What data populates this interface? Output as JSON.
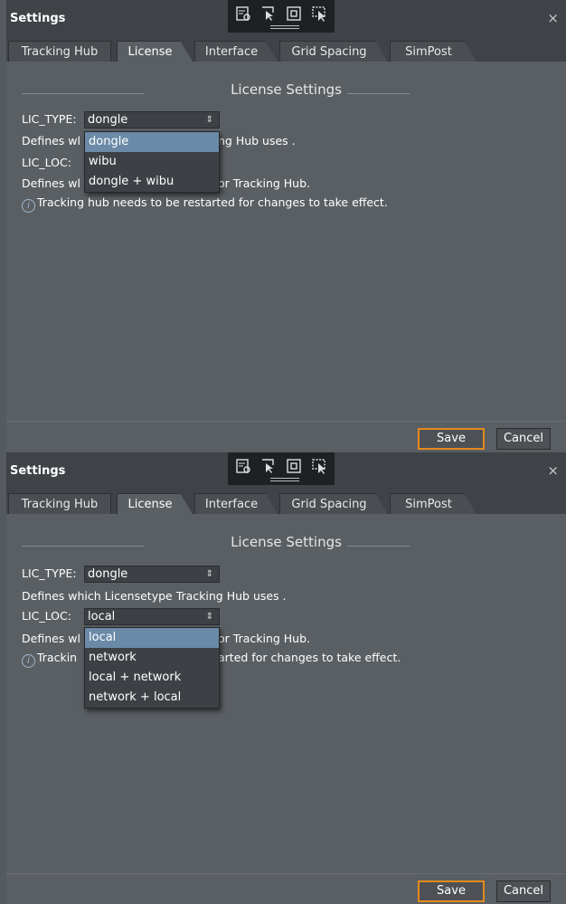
{
  "colors": {
    "accent": "#e48a1c",
    "selection": "#6a8aa7",
    "panel": "#5a5f63",
    "titlebar": "#3f4347"
  },
  "toolbar_icons": [
    "settings-list-icon",
    "select-arrow-icon",
    "frame-icon",
    "area-select-icon"
  ],
  "panels": [
    {
      "title": "Settings",
      "close": "×",
      "tabs": [
        "Tracking Hub",
        "License",
        "Interface",
        "Grid Spacing",
        "SimPost"
      ],
      "active_tab": "License",
      "section_header": "License Settings",
      "lic_type_label": "LIC_TYPE:",
      "lic_type_value": "dongle",
      "line1_left": "Defines wl",
      "line1_right": "ng Hub uses .",
      "lic_loc_label": "LIC_LOC:",
      "line2_left": "Defines wl",
      "line2_right": "or Tracking Hub.",
      "info_text": "Tracking hub needs to be restarted for changes to take effect.",
      "dropdown_options": [
        "dongle",
        "wibu",
        "dongle + wibu"
      ],
      "dropdown_selected": "dongle",
      "save": "Save",
      "cancel": "Cancel"
    },
    {
      "title": "Settings",
      "close": "×",
      "tabs": [
        "Tracking Hub",
        "License",
        "Interface",
        "Grid Spacing",
        "SimPost"
      ],
      "active_tab": "License",
      "section_header": "License Settings",
      "lic_type_label": "LIC_TYPE:",
      "lic_type_value": "dongle",
      "line1": "Defines which Licensetype Tracking Hub uses .",
      "lic_loc_label": "LIC_LOC:",
      "lic_loc_value": "local",
      "line2_left": "Defines wl",
      "line2_right": "or Tracking Hub.",
      "info_left": "Trackin",
      "info_right": "arted for changes to take effect.",
      "dropdown_options": [
        "local",
        "network",
        "local + network",
        "network + local"
      ],
      "dropdown_selected": "local",
      "save": "Save",
      "cancel": "Cancel"
    }
  ]
}
